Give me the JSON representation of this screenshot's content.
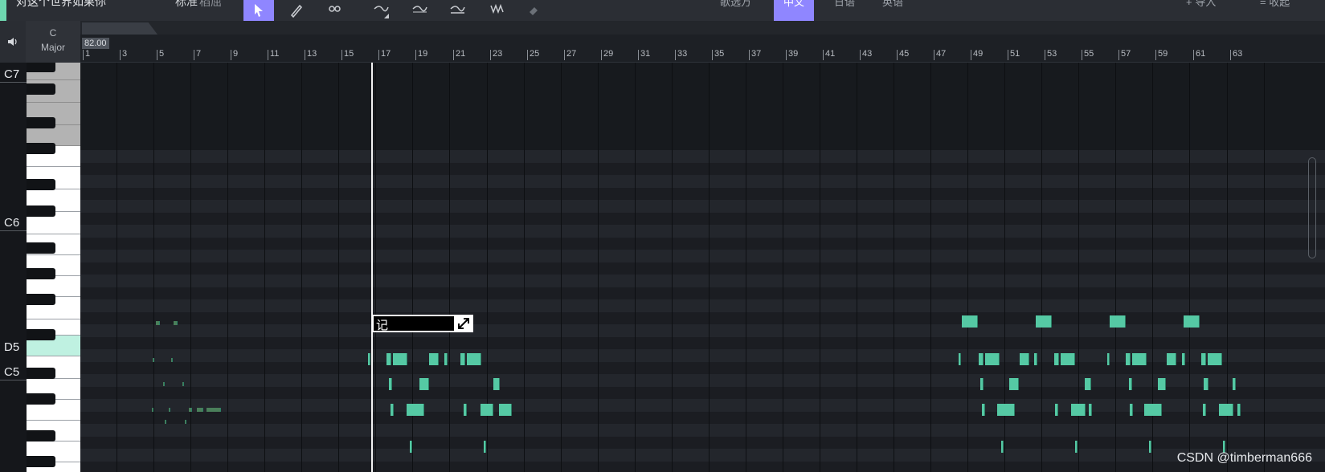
{
  "toolbar": {
    "song_title": "对这个世界如果你",
    "mode_label": "标准",
    "mode_sub": "稻屈",
    "tools": [
      "select-tool",
      "pencil-tool",
      "scissors-tool",
      "pitch-curve-tool",
      "vibrato-tool",
      "dynamics-tool",
      "wave-tool",
      "eraser-tool"
    ],
    "lang_prefix": "歌选万",
    "lang_active": "中文",
    "lang_japanese": "日语",
    "lang_english": "英语",
    "import_label": "导入",
    "collapse_label": "收起"
  },
  "key_signature": {
    "tonic": "C",
    "mode": "Major"
  },
  "piano": {
    "labels": {
      "c7": "C7",
      "c6": "C6",
      "d5": "D5",
      "c5": "C5"
    }
  },
  "ruler": {
    "tempo": "82.00",
    "bars": [
      "1",
      "3",
      "5",
      "7",
      "9",
      "11",
      "13",
      "15",
      "17",
      "19",
      "21",
      "23",
      "25",
      "27",
      "29",
      "31",
      "33",
      "35",
      "37",
      "39",
      "41",
      "43",
      "45",
      "47",
      "49",
      "51",
      "53",
      "55",
      "57",
      "59",
      "61",
      "63"
    ]
  },
  "lyric_editor": {
    "text": "记"
  },
  "watermark": "CSDN @timberman666",
  "colors": {
    "accent": "#8f86ff",
    "note": "#55c9a4",
    "background": "#1e2126",
    "highlight_key": "#bff1e1"
  }
}
